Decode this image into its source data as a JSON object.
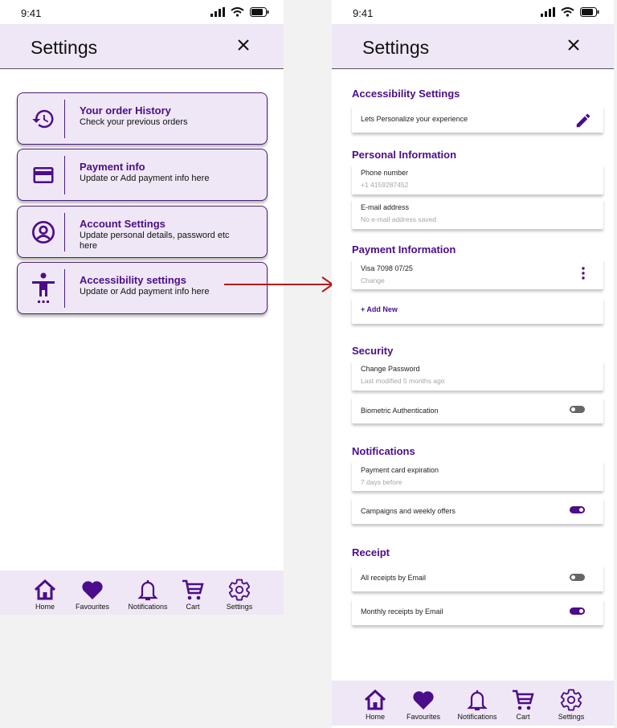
{
  "status": {
    "time": "9:41"
  },
  "colors": {
    "accent": "#4b0d8a",
    "header_bg": "#efe7f5",
    "arrow": "#b01b1b",
    "toggle_off": "#666666"
  },
  "left_screen": {
    "header": {
      "title": "Settings",
      "close_icon": "close-icon"
    },
    "menu": [
      {
        "icon": "history-icon",
        "title": "Your order History",
        "subtitle": "Check your previous orders"
      },
      {
        "icon": "credit-card-icon",
        "title": "Payment info",
        "subtitle": "Update or Add payment info here"
      },
      {
        "icon": "account-circle-icon",
        "title": "Account Settings",
        "subtitle": "Update personal details, password etc here"
      },
      {
        "icon": "accessibility-icon",
        "title": "Accessibility settings",
        "subtitle": "Update or Add payment info here"
      }
    ]
  },
  "right_screen": {
    "header": {
      "title": "Settings",
      "close_icon": "close-icon"
    },
    "sections": {
      "accessibility": {
        "title": "Accessibility Settings",
        "item": "Lets Personalize your experience",
        "icon": "edit-icon"
      },
      "personal": {
        "title": "Personal Information",
        "phone": {
          "label": "Phone number",
          "placeholder": "+1 4159287452"
        },
        "email": {
          "label": "E-mail address",
          "placeholder": "No e-mail address saved"
        }
      },
      "payment": {
        "title": "Payment Information",
        "card": {
          "label": "Visa 7098  07/25",
          "sub": "Change"
        },
        "add_new": "+ Add New"
      },
      "security": {
        "title": "Security",
        "password": {
          "label": "Change Password",
          "sub": "Last modified 5 months ago"
        },
        "biometric": {
          "label": "Biometric Authentication",
          "enabled": false
        }
      },
      "notifications": {
        "title": "Notifications",
        "card_expiry": {
          "label": "Payment card expiration",
          "sub": "7 days before"
        },
        "campaigns": {
          "label": "Campaigns and weekly offers",
          "enabled": true
        }
      },
      "receipt": {
        "title": "Receipt",
        "all_email": {
          "label": "All receipts by Email",
          "enabled": false
        },
        "monthly_email": {
          "label": "Monthly receipts by Email",
          "enabled": true
        }
      }
    }
  },
  "bottom_nav": [
    {
      "label": "Home",
      "icon": "home-icon"
    },
    {
      "label": "Favourites",
      "icon": "heart-icon"
    },
    {
      "label": "Notifications",
      "icon": "bell-icon"
    },
    {
      "label": "Cart",
      "icon": "cart-icon"
    },
    {
      "label": "Settings",
      "icon": "gear-icon"
    }
  ]
}
